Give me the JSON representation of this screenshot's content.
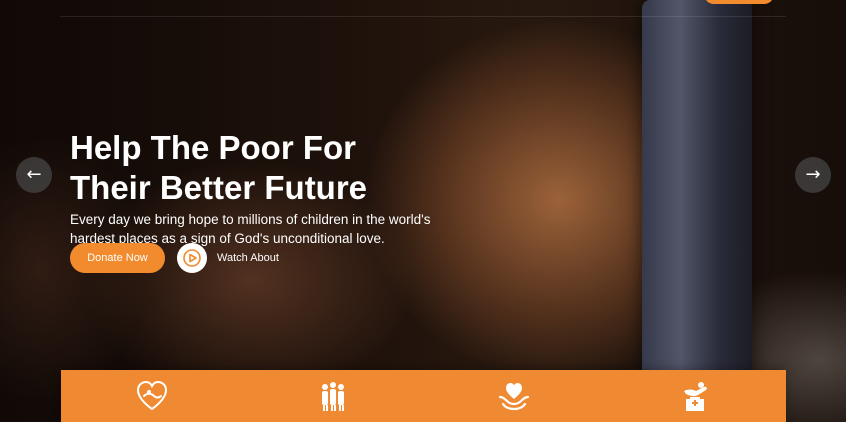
{
  "hero": {
    "title_line1": "Help The Poor For",
    "title_line2": "Their Better Future",
    "subtitle": "Every day we bring hope to millions of children in the world's hardest places as a sign of God's unconditional love.",
    "donate_label": "Donate Now",
    "watch_label": "Watch About"
  },
  "slider": {
    "prev_icon": "arrow-left-icon",
    "next_icon": "arrow-right-icon"
  },
  "features": {
    "icons": [
      "heart-hands-icon",
      "group-people-icon",
      "heart-in-hands-icon",
      "donation-box-icon"
    ]
  },
  "colors": {
    "accent": "#f28a2e",
    "feature_bar": "#ef8a33",
    "text": "#ffffff"
  }
}
